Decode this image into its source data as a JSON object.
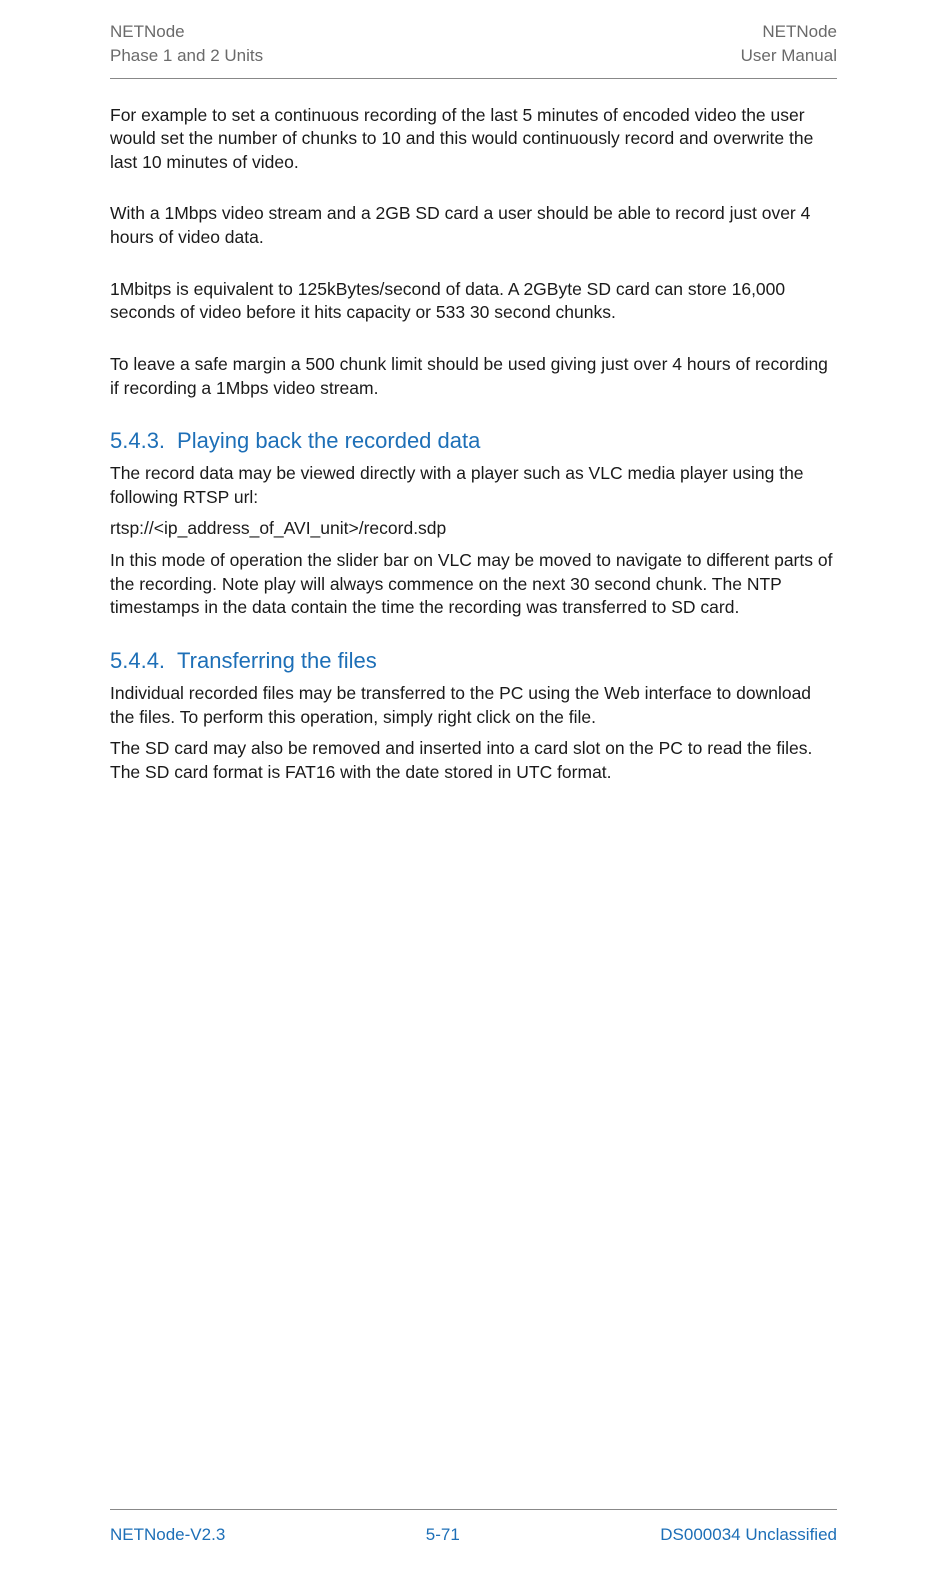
{
  "header": {
    "left_line1": "NETNode",
    "left_line2": "Phase 1 and 2 Units",
    "right_line1": "NETNode",
    "right_line2": "User Manual"
  },
  "paragraphs": {
    "p1": "For example to set a continuous recording of the last 5 minutes of encoded video the user would set the number of chunks to 10 and this would continuously record and overwrite the last 10 minutes of video.",
    "p2": "With a 1Mbps video stream and a 2GB SD card a user should be able to record just over 4 hours of video data.",
    "p3": "1Mbitps is equivalent to 125kBytes/second of data. A 2GByte SD card can store 16,000 seconds of video before it hits capacity or 533 30 second chunks.",
    "p4": "To leave a safe margin a 500 chunk limit should be used giving just over 4 hours of recording if recording a 1Mbps video stream.",
    "p5": "The record data may be viewed directly with a player such as VLC media player using the following RTSP url:",
    "p6": "rtsp://<ip_address_of_AVI_unit>/record.sdp",
    "p7": "In this mode of operation the slider bar on VLC may be moved to navigate to different parts of the recording. Note play will always commence on the next 30 second chunk. The NTP timestamps in the data contain the time the recording was transferred to SD card.",
    "p8": "Individual recorded files may be transferred to the PC using the Web interface to download the files. To perform this operation, simply right click on the file.",
    "p9": "The SD card may also be removed and inserted into a card slot on the PC to read the files. The SD card format is FAT16 with the date stored in UTC format."
  },
  "headings": {
    "h1_number": "5.4.3.",
    "h1_text": "Playing back the recorded data",
    "h2_number": "5.4.4.",
    "h2_text": "Transferring the files"
  },
  "footer": {
    "left": "NETNode-V2.3",
    "center": "5-71",
    "right": "DS000034 Unclassified"
  }
}
